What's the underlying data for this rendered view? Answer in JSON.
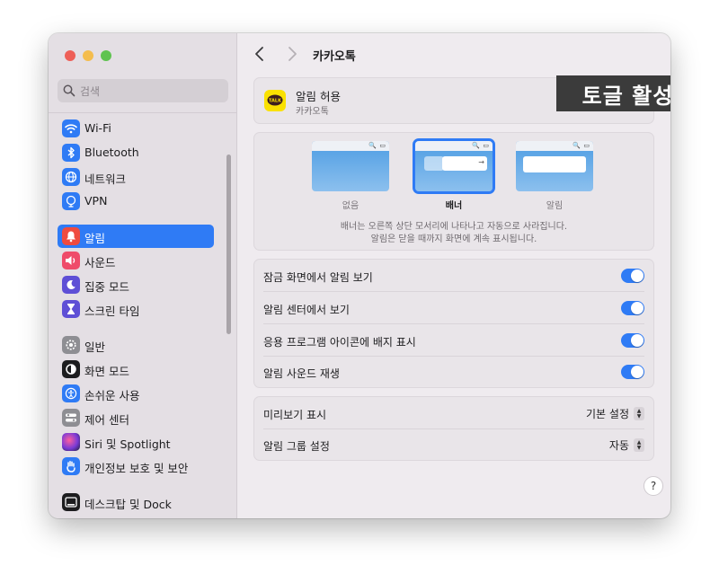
{
  "sidebar": {
    "search_placeholder": "검색",
    "items": [
      {
        "label": "Wi-Fi",
        "icon": "wifi-icon",
        "color": "#2f7bf5"
      },
      {
        "label": "Bluetooth",
        "icon": "bluetooth-icon",
        "color": "#2f7bf5"
      },
      {
        "label": "네트워크",
        "icon": "globe-icon",
        "color": "#2f7bf5"
      },
      {
        "label": "VPN",
        "icon": "vpn-globe-icon",
        "color": "#2f7bf5"
      },
      {
        "label": "알림",
        "icon": "bell-icon",
        "color": "#ef4b3f",
        "active": true
      },
      {
        "label": "사운드",
        "icon": "speaker-icon",
        "color": "#ef4b6a"
      },
      {
        "label": "집중 모드",
        "icon": "moon-icon",
        "color": "#5e4fd6"
      },
      {
        "label": "스크린 타임",
        "icon": "hourglass-icon",
        "color": "#5e4fd6"
      },
      {
        "label": "일반",
        "icon": "gear-icon",
        "color": "#8e8e93"
      },
      {
        "label": "화면 모드",
        "icon": "appearance-icon",
        "color": "#1d1d1f"
      },
      {
        "label": "손쉬운 사용",
        "icon": "accessibility-icon",
        "color": "#2f7bf5"
      },
      {
        "label": "제어 센터",
        "icon": "control-center-icon",
        "color": "#8e8e93"
      },
      {
        "label": "Siri 및 Spotlight",
        "icon": "siri-icon",
        "color": "#a33bd6"
      },
      {
        "label": "개인정보 보호 및 보안",
        "icon": "hand-icon",
        "color": "#2f7bf5"
      },
      {
        "label": "데스크탑 및 Dock",
        "icon": "dock-icon",
        "color": "#1d1d1f"
      }
    ]
  },
  "header": {
    "title": "카카오톡"
  },
  "allow": {
    "label": "알림 허용",
    "app_name": "카카오톡",
    "app_icon_text": "TALK",
    "enabled": true
  },
  "annotation": {
    "text": "토글 활성화",
    "color": "#e01e1e"
  },
  "styles": {
    "options": [
      {
        "label": "없음",
        "selected": false
      },
      {
        "label": "배너",
        "selected": true
      },
      {
        "label": "알림",
        "selected": false
      }
    ],
    "desc_line1": "배너는 오른쪽 상단 모서리에 나타나고 자동으로 사라집니다.",
    "desc_line2": "알림은 닫을 때까지 화면에 계속 표시됩니다."
  },
  "toggles": [
    {
      "label": "잠금 화면에서 알림 보기",
      "on": true
    },
    {
      "label": "알림 센터에서 보기",
      "on": true
    },
    {
      "label": "응용 프로그램 아이콘에 배지 표시",
      "on": true
    },
    {
      "label": "알림 사운드 재생",
      "on": true
    }
  ],
  "popups": [
    {
      "label": "미리보기 표시",
      "value": "기본 설정"
    },
    {
      "label": "알림 그룹 설정",
      "value": "자동"
    }
  ],
  "help_label": "?",
  "accent_color": "#2f7bf5"
}
